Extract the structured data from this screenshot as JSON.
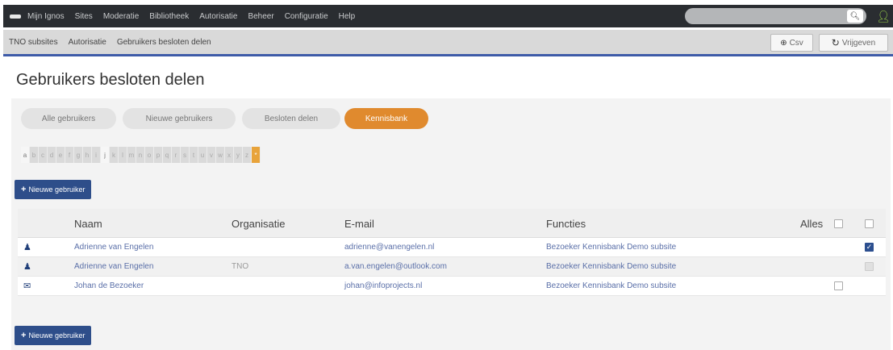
{
  "topbar": {
    "menu": [
      "Mijn Ignos",
      "Sites",
      "Moderatie",
      "Bibliotheek",
      "Autorisatie",
      "Beheer",
      "Configuratie",
      "Help"
    ],
    "search_placeholder": "",
    "search_icon": "search-icon",
    "user_icon": "user-icon"
  },
  "subbar": {
    "breadcrumbs": [
      "TNO subsites",
      "Autorisatie",
      "Gebruikers besloten delen"
    ],
    "csv_label": "Csv",
    "refresh_label": "Vrijgeven"
  },
  "page": {
    "title": "Gebruikers besloten delen"
  },
  "tabs": [
    {
      "label": "Alle gebruikers",
      "active": false
    },
    {
      "label": "Nieuwe gebruikers",
      "active": false
    },
    {
      "label": "Besloten delen",
      "active": false
    },
    {
      "label": "Kennisbank",
      "active": true
    }
  ],
  "alphabet": [
    "a",
    "b",
    "c",
    "d",
    "e",
    "f",
    "g",
    "h",
    "i",
    "j",
    "k",
    "l",
    "m",
    "n",
    "o",
    "p",
    "q",
    "r",
    "s",
    "t",
    "u",
    "v",
    "w",
    "x",
    "y",
    "z",
    "*"
  ],
  "new_user_label": "Nieuwe gebruiker",
  "table": {
    "headers": {
      "name": "Naam",
      "organisation": "Organisatie",
      "email": "E-mail",
      "functions": "Functies",
      "all": "Alles"
    },
    "rows": [
      {
        "icon": "user-admin-icon",
        "name": "Adrienne van Engelen",
        "organisation": "",
        "email": "adrienne@vanengelen.nl",
        "functions": "Bezoeker Kennisbank Demo subsite",
        "checked": true,
        "disabled": false,
        "cb_position": "right"
      },
      {
        "icon": "user-icon",
        "name": "Adrienne van Engelen",
        "organisation": "TNO",
        "email": "a.van.engelen@outlook.com",
        "functions": "Bezoeker Kennisbank Demo subsite",
        "checked": false,
        "disabled": true,
        "cb_position": "right"
      },
      {
        "icon": "briefcase-user-icon",
        "name": "Johan de Bezoeker",
        "organisation": "",
        "email": "johan@infoprojects.nl",
        "functions": "Bezoeker Kennisbank Demo subsite",
        "checked": false,
        "disabled": false,
        "cb_position": "left"
      }
    ]
  },
  "colors": {
    "accent": "#e08a2e",
    "primary": "#2e4e8a",
    "topbar": "#2a2d31",
    "link": "#5a6fa8"
  }
}
